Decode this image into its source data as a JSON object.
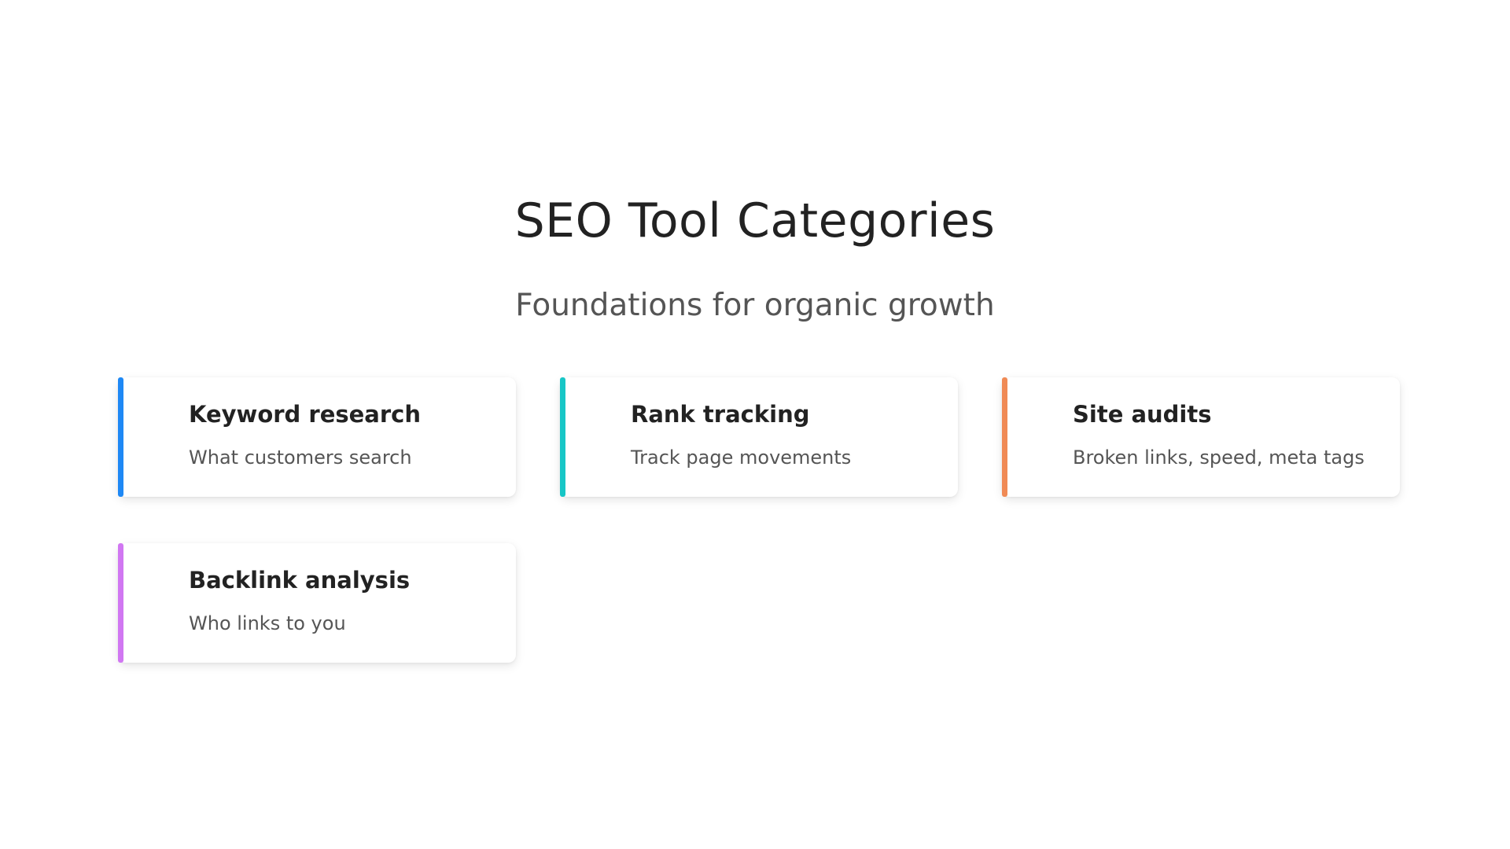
{
  "header": {
    "title": "SEO Tool Categories",
    "subtitle": "Foundations for organic growth"
  },
  "cards": [
    {
      "title": "Keyword research",
      "description": "What customers search",
      "accent": "#1e88f5"
    },
    {
      "title": "Rank tracking",
      "description": "Track page movements",
      "accent": "#17c6c6"
    },
    {
      "title": "Site audits",
      "description": "Broken links, speed, meta tags",
      "accent": "#f08a55"
    },
    {
      "title": "Backlink analysis",
      "description": "Who links to you",
      "accent": "#d177f2"
    }
  ]
}
